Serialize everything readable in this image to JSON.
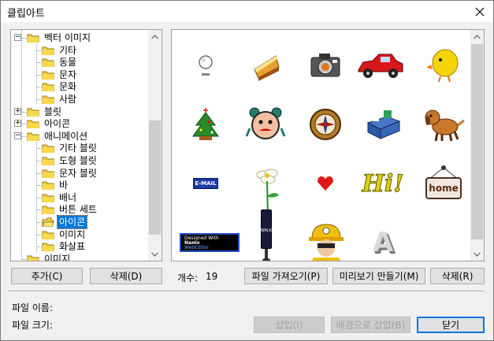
{
  "window": {
    "title": "클립아트"
  },
  "tree": {
    "items": [
      {
        "label": "벡터 이미지",
        "level": 0,
        "expander": "−"
      },
      {
        "label": "기타",
        "level": 1
      },
      {
        "label": "동물",
        "level": 1
      },
      {
        "label": "문자",
        "level": 1
      },
      {
        "label": "문화",
        "level": 1
      },
      {
        "label": "사람",
        "level": 1
      },
      {
        "label": "블릿",
        "level": 0,
        "expander": "+"
      },
      {
        "label": "아이콘",
        "level": 0,
        "expander": "+"
      },
      {
        "label": "애니메이션",
        "level": 0,
        "expander": "−"
      },
      {
        "label": "기타 블릿",
        "level": 1
      },
      {
        "label": "도형 블릿",
        "level": 1
      },
      {
        "label": "문자 블릿",
        "level": 1
      },
      {
        "label": "바",
        "level": 1
      },
      {
        "label": "배너",
        "level": 1
      },
      {
        "label": "버튼 세트",
        "level": 1
      },
      {
        "label": "아이콘",
        "level": 1,
        "selected": true
      },
      {
        "label": "이미지",
        "level": 1
      },
      {
        "label": "화살표",
        "level": 1
      },
      {
        "label": "이미지",
        "level": 0
      }
    ]
  },
  "clips": [
    "bulb-clip",
    "cake-clip",
    "camera-clip",
    "car-clip",
    "chick-clip",
    "christmas-tree-clip",
    "alarm-clock-clip",
    "compass-clip",
    "desk-clip",
    "dog-clip",
    "email-clip",
    "flower-clip",
    "heart-clip",
    "hi-clip",
    "home-sign-clip",
    "webeditor-banner-clip",
    "walk-signal-clip",
    "worker-clip",
    "letter-a-clip"
  ],
  "clip_text": {
    "email": "E-MAIL",
    "home": "home",
    "hi": "Hi!",
    "walk": "WALK",
    "banner_line1": "Designed With",
    "banner_line2": "Namo",
    "banner_line3": "WebEditor",
    "letter": "A"
  },
  "toolbar": {
    "add": "추가(C)",
    "delete_category": "삭제(D)",
    "count_label": "개수:",
    "count_value": "19",
    "import": "파일 가져오기(P)",
    "preview": "미리보기 만들기(M)",
    "delete_file": "삭제(R)"
  },
  "info": {
    "filename_label": "파일 이름:",
    "filesize_label": "파일 크기:"
  },
  "footer": {
    "insert": "삽입(I)",
    "insert_bg": "배경으로 삽입(B)",
    "close": "닫기"
  }
}
